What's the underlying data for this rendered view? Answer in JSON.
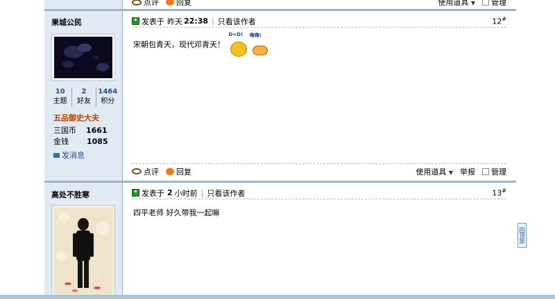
{
  "top_actions": {
    "comment": "点评",
    "reply": "回复",
    "tools": "使用道具",
    "manage": "管理"
  },
  "posts": [
    {
      "user": {
        "name": "果城公民",
        "stats": [
          {
            "value": "10",
            "label": "主题"
          },
          {
            "value": "2",
            "label": "好友"
          },
          {
            "value": "1464",
            "label": "积分"
          }
        ],
        "rank": "五品御史大夫",
        "fields": [
          {
            "key": "三国币",
            "value": "1661"
          },
          {
            "key": "金钱",
            "value": "1085"
          }
        ],
        "message_link": "发消息"
      },
      "header": {
        "posted_prefix": "发表于",
        "time_prefix": "昨天",
        "time": "22:38",
        "only_author": "只看该作者",
        "floor": "12",
        "floor_sup": "#"
      },
      "content": "宋朝包青天，现代邓青天！",
      "emoticons": [
        {
          "tag": "D=D!"
        },
        {
          "tag": "嗨嗨!"
        }
      ],
      "actions": {
        "comment": "点评",
        "reply": "回复",
        "tools": "使用道具",
        "report": "举报",
        "manage": "管理"
      }
    },
    {
      "user": {
        "name": "高处不胜寒"
      },
      "header": {
        "posted_prefix": "发表于",
        "time_num": "2",
        "time_suffix": "小时前",
        "only_author": "只看该作者",
        "floor": "13",
        "floor_sup": "#"
      },
      "content": "四平老师 好久带我一起嘛"
    }
  ],
  "back_to_top": "回顶部",
  "colors": {
    "side_bg": "#e1eaf2",
    "border": "#9db3c5",
    "link": "#1f4a8f",
    "rank": "#c04000"
  }
}
